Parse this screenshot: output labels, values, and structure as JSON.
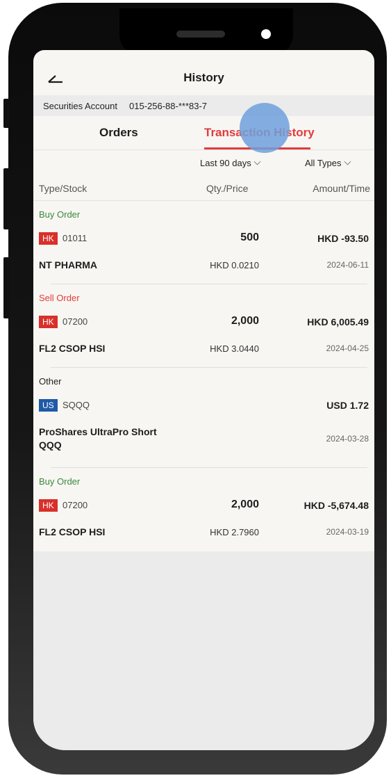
{
  "header": {
    "title": "History"
  },
  "account": {
    "label": "Securities Account",
    "number": "015-256-88-***83-7"
  },
  "tabs": [
    {
      "label": "Orders",
      "active": false
    },
    {
      "label": "Transaction History",
      "active": true
    }
  ],
  "filters": {
    "period": "Last 90 days",
    "type": "All Types"
  },
  "columns": {
    "type_stock": "Type/Stock",
    "qty_price": "Qty./Price",
    "amount_time": "Amount/Time"
  },
  "colors": {
    "accent": "#e23b3b",
    "buy": "#3a8a3a",
    "sell": "#e23b3b",
    "hk_badge": "#d9302a",
    "us_badge": "#1f5aa6"
  },
  "transactions": [
    {
      "type": "Buy Order",
      "market": "HK",
      "code": "01011",
      "qty": "500",
      "amount": "HKD -93.50",
      "name": "NT PHARMA",
      "price": "HKD 0.0210",
      "date": "2024-06-11"
    },
    {
      "type": "Sell Order",
      "market": "HK",
      "code": "07200",
      "qty": "2,000",
      "amount": "HKD 6,005.49",
      "name": "FL2 CSOP HSI",
      "price": "HKD 3.0440",
      "date": "2024-04-25"
    },
    {
      "type": "Other",
      "market": "US",
      "code": "SQQQ",
      "qty": "",
      "amount": "USD 1.72",
      "name": "ProShares UltraPro Short QQQ",
      "price": "",
      "date": "2024-03-28"
    },
    {
      "type": "Buy Order",
      "market": "HK",
      "code": "07200",
      "qty": "2,000",
      "amount": "HKD -5,674.48",
      "name": "FL2 CSOP HSI",
      "price": "HKD 2.7960",
      "date": "2024-03-19"
    }
  ]
}
